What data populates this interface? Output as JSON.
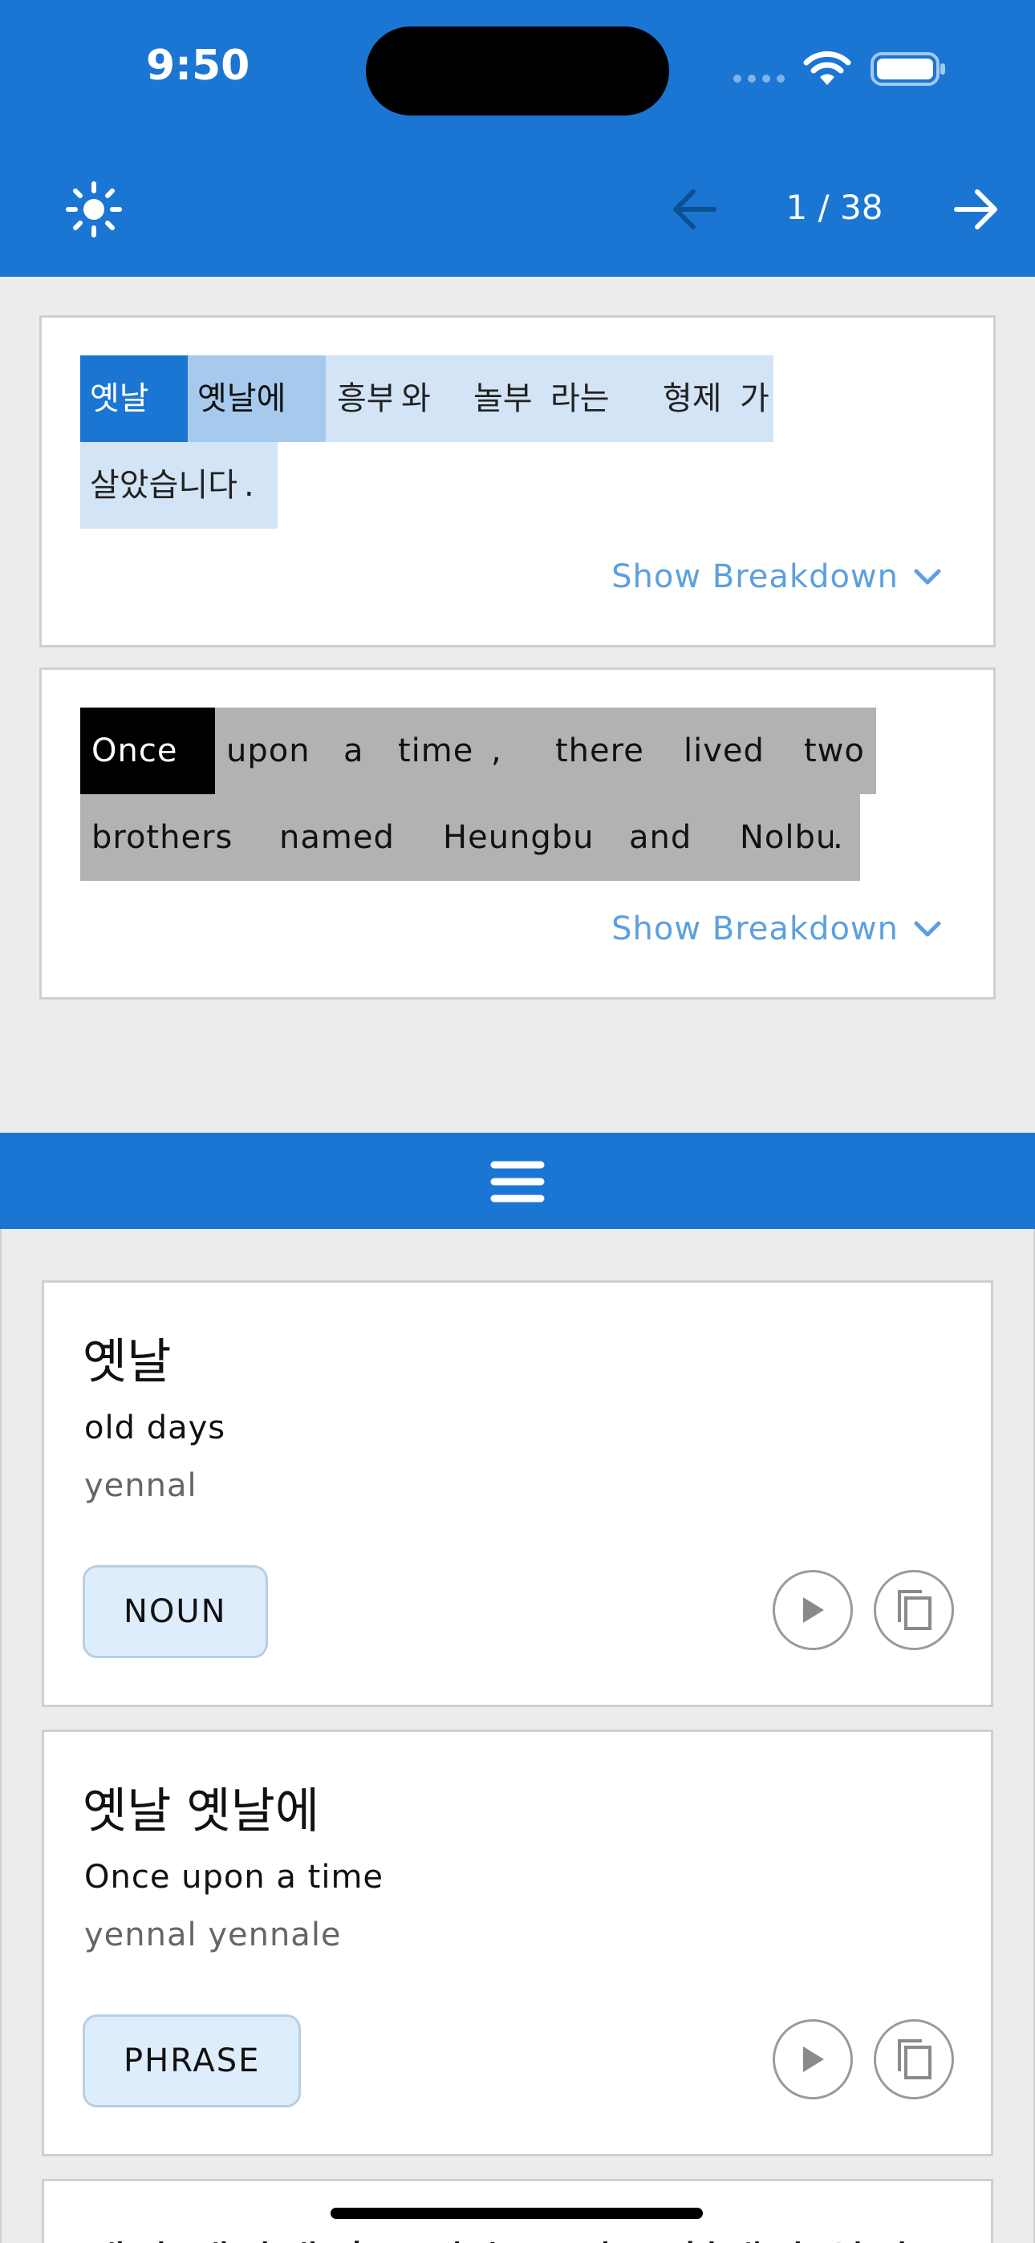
{
  "status_bar": {
    "time": "9:50"
  },
  "header": {
    "page_counter": "1 / 38",
    "icons": {
      "theme": "sun-icon",
      "back": "arrow-left-icon",
      "next": "arrow-right-icon"
    }
  },
  "sentence": {
    "korean_tokens": [
      [
        "옛날",
        "옛날에",
        "흥부",
        "와",
        "놀부",
        "라는",
        "형제",
        "가"
      ],
      [
        "살았습니다",
        "."
      ]
    ],
    "english_tokens": [
      [
        "Once",
        "upon",
        "a",
        "time",
        ",",
        "there",
        "lived",
        "two"
      ],
      [
        "brothers",
        "named",
        "Heungbu",
        "and",
        "Nolbu",
        "."
      ]
    ],
    "show_breakdown_label": "Show Breakdown"
  },
  "word_cards": [
    {
      "term": "옛날",
      "meaning": "old days",
      "romanization": "yennal",
      "pos": "NOUN"
    },
    {
      "term": "옛날 옛날에",
      "meaning": "Once upon a time",
      "romanization": "yennal yennale",
      "pos": "PHRASE"
    }
  ],
  "peek_card": {
    "term": "옛날 옛날에 흥부와 놀부라는 형제가 살았"
  },
  "colors": {
    "primary": "#1b76d3",
    "highlight": "#a6caee",
    "token_bg": "#d2e4f6",
    "link": "#5ba0e0"
  }
}
